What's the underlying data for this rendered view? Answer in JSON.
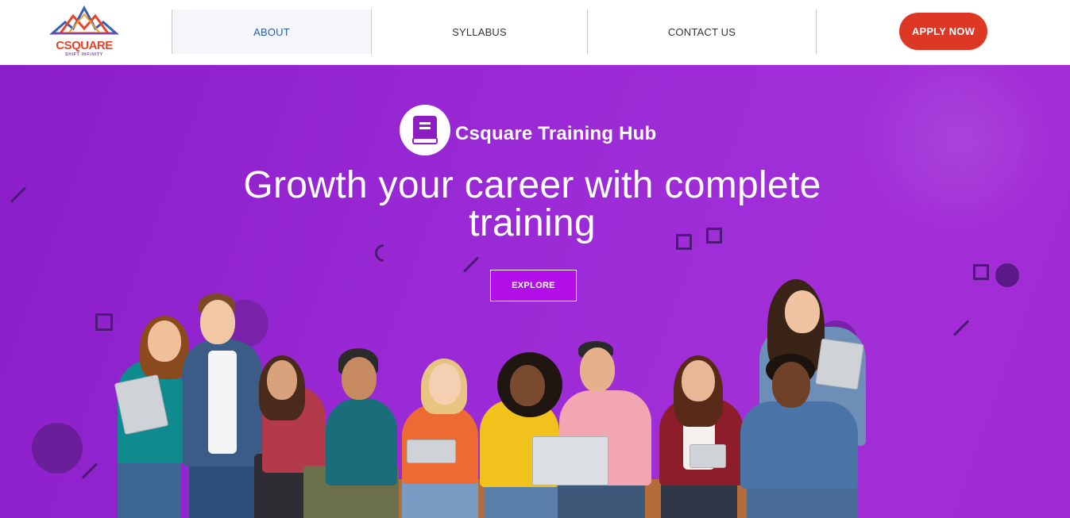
{
  "brand": {
    "logo_text": "CSQUARE",
    "logo_tagline": "SHIFT INFINITY",
    "name": "Csquare Training Hub",
    "icon": "book-icon",
    "colors": {
      "primary_purple": "#9a2ad6",
      "apply_red": "#dd3725",
      "explore_bg": "#b20fe8",
      "nav_active_text": "#2a5daa"
    }
  },
  "nav": {
    "items": [
      {
        "label": "ABOUT",
        "active": true
      },
      {
        "label": "SYLLABUS",
        "active": false
      },
      {
        "label": "CONTACT US",
        "active": false
      }
    ],
    "apply_label": "APPLY NOW"
  },
  "hero": {
    "headline_line1": "Growth your career with complete",
    "headline_line2": "training",
    "explore_label": "EXPLORE",
    "image": "group-of-students"
  }
}
